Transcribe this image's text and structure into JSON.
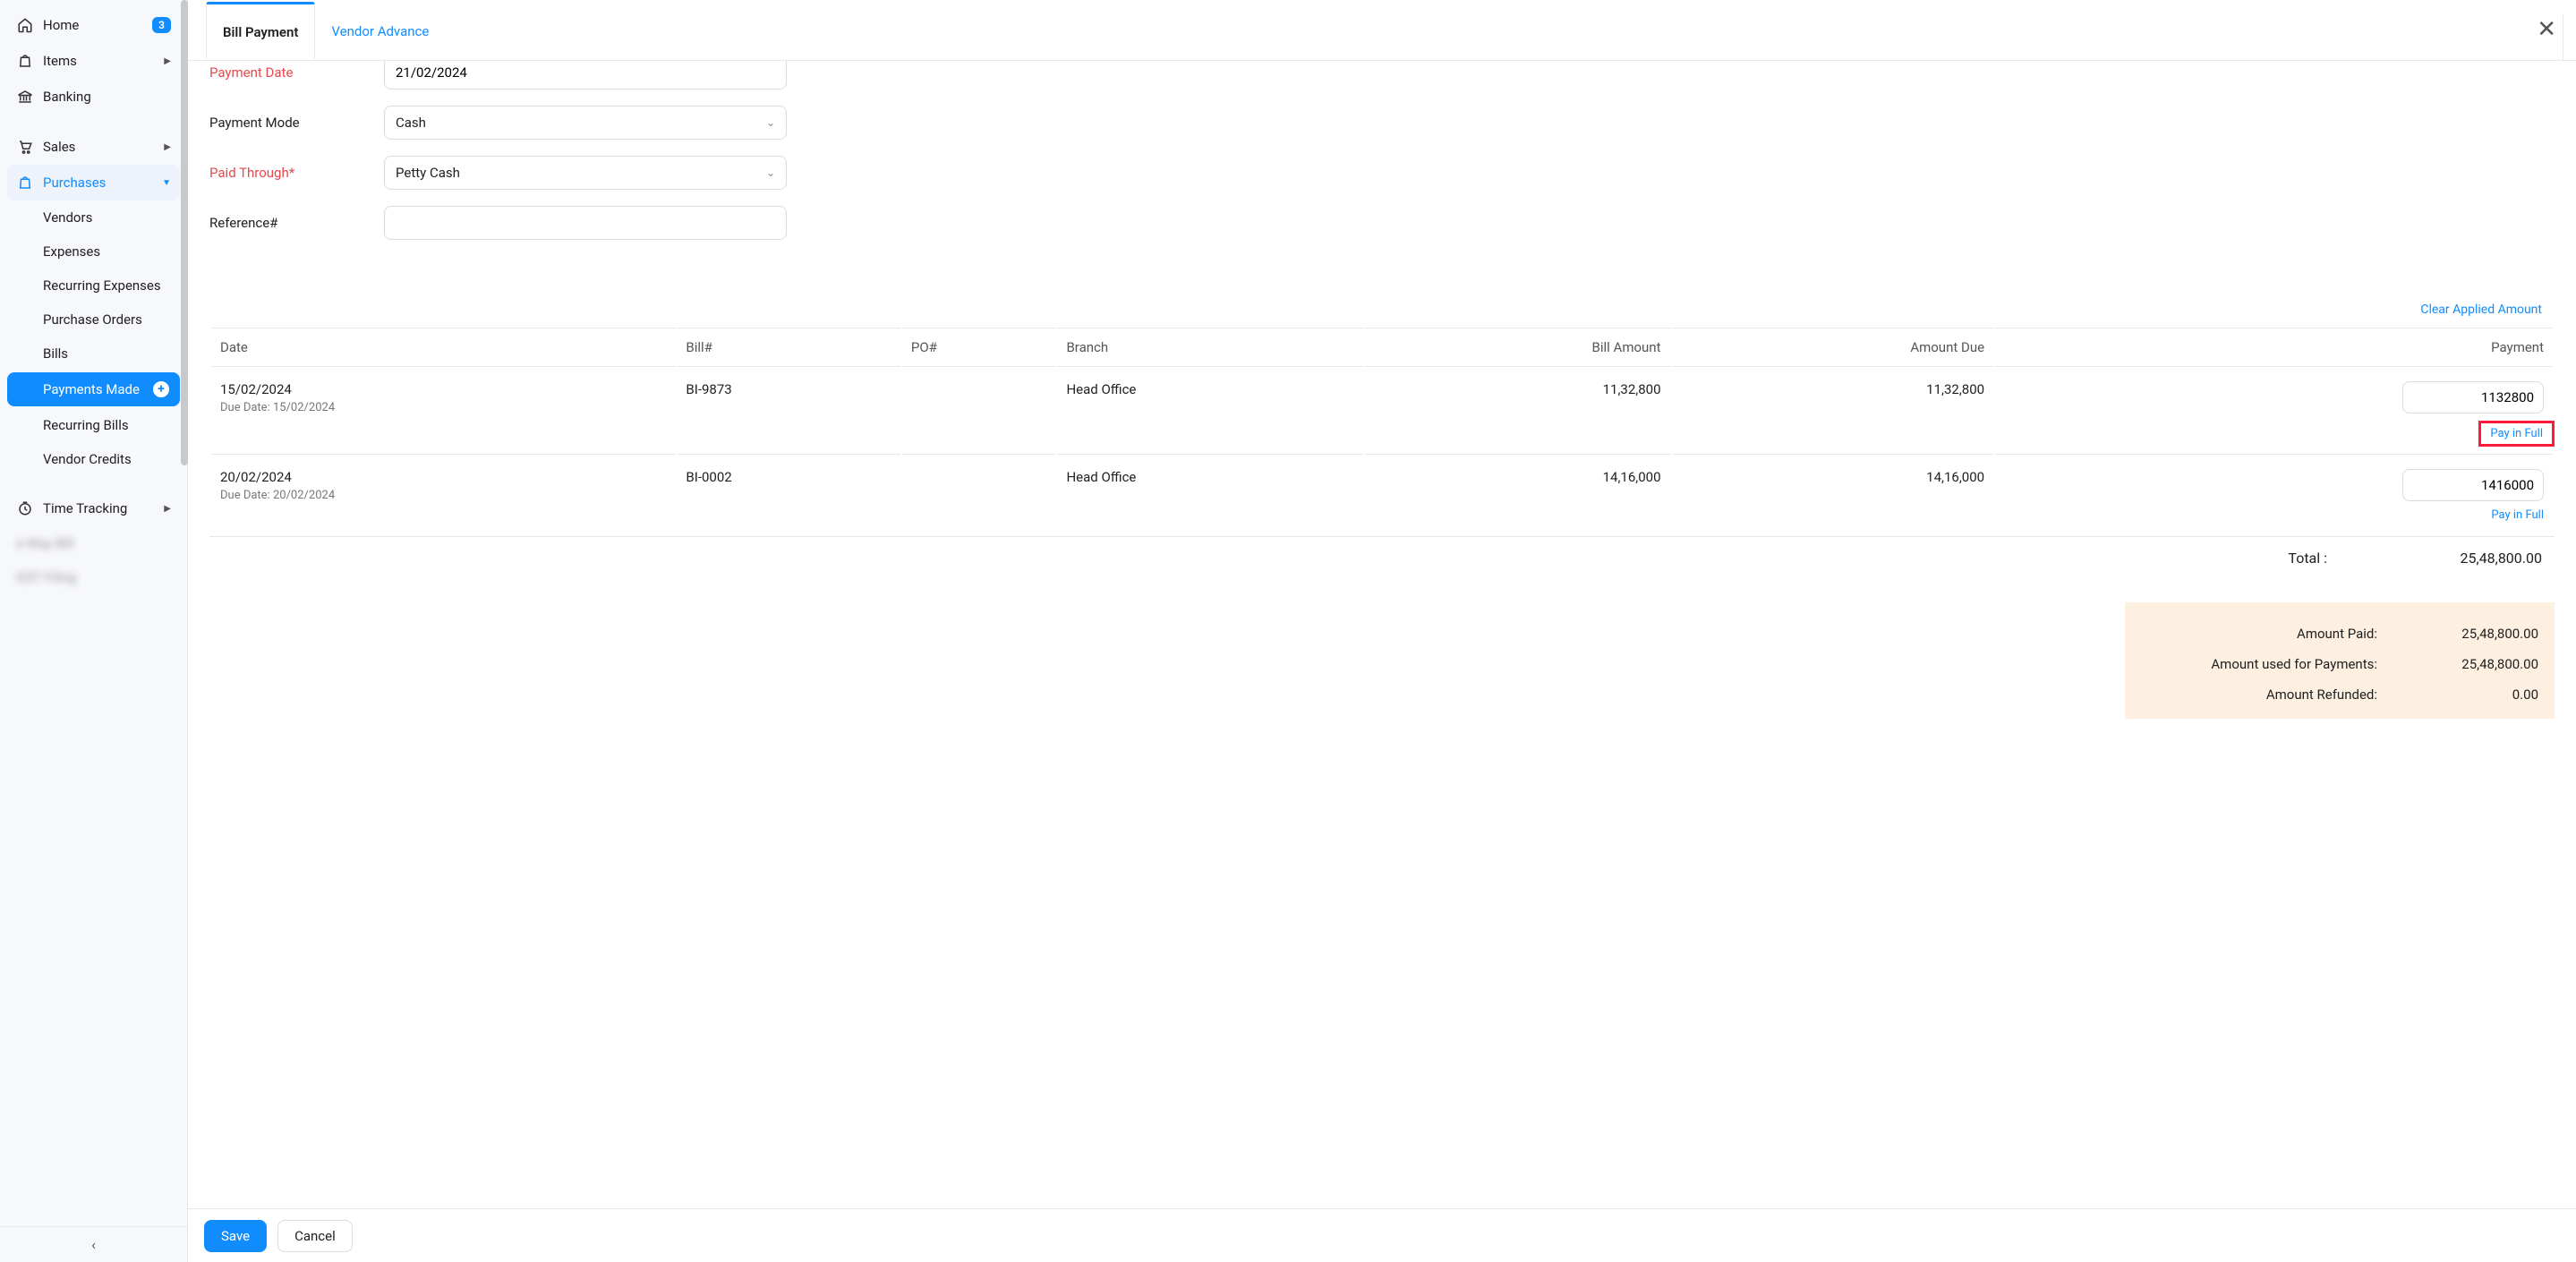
{
  "sidebar": {
    "home": {
      "label": "Home",
      "badge": "3"
    },
    "items": {
      "label": "Items"
    },
    "banking": {
      "label": "Banking"
    },
    "sales": {
      "label": "Sales"
    },
    "purchases": {
      "label": "Purchases"
    },
    "purchases_sub": {
      "vendors": "Vendors",
      "expenses": "Expenses",
      "recurring_expenses": "Recurring Expenses",
      "purchase_orders": "Purchase Orders",
      "bills": "Bills",
      "payments_made": "Payments Made",
      "recurring_bills": "Recurring Bills",
      "vendor_credits": "Vendor Credits"
    },
    "time_tracking": {
      "label": "Time Tracking"
    },
    "blurred1": "e-Way Bill",
    "blurred2": "GST Filing"
  },
  "tabs": {
    "bill_payment": "Bill Payment",
    "vendor_advance": "Vendor Advance"
  },
  "form": {
    "payment_date_label": "Payment Date",
    "payment_date_value": "21/02/2024",
    "payment_mode_label": "Payment Mode",
    "payment_mode_value": "Cash",
    "paid_through_label": "Paid Through*",
    "paid_through_value": "Petty Cash",
    "reference_label": "Reference#",
    "reference_value": ""
  },
  "table": {
    "clear_link": "Clear Applied Amount",
    "headers": {
      "date": "Date",
      "bill": "Bill#",
      "po": "PO#",
      "branch": "Branch",
      "bill_amount": "Bill Amount",
      "amount_due": "Amount Due",
      "payment": "Payment"
    },
    "rows": [
      {
        "date": "15/02/2024",
        "due_prefix": "Due Date: ",
        "due_date": "15/02/2024",
        "bill": "BI-9873",
        "po": "",
        "branch": "Head Office",
        "bill_amount": "11,32,800",
        "amount_due": "11,32,800",
        "payment_input": "1132800",
        "pay_in_full": "Pay in Full"
      },
      {
        "date": "20/02/2024",
        "due_prefix": "Due Date: ",
        "due_date": "20/02/2024",
        "bill": "BI-0002",
        "po": "",
        "branch": "Head Office",
        "bill_amount": "14,16,000",
        "amount_due": "14,16,000",
        "payment_input": "1416000",
        "pay_in_full": "Pay in Full"
      }
    ],
    "total_label": "Total :",
    "total_value": "25,48,800.00"
  },
  "summary": {
    "amount_paid_label": "Amount Paid:",
    "amount_paid_value": "25,48,800.00",
    "amount_used_label": "Amount used for Payments:",
    "amount_used_value": "25,48,800.00",
    "amount_refunded_label": "Amount Refunded:",
    "amount_refunded_value": "0.00"
  },
  "footer": {
    "save": "Save",
    "cancel": "Cancel"
  }
}
